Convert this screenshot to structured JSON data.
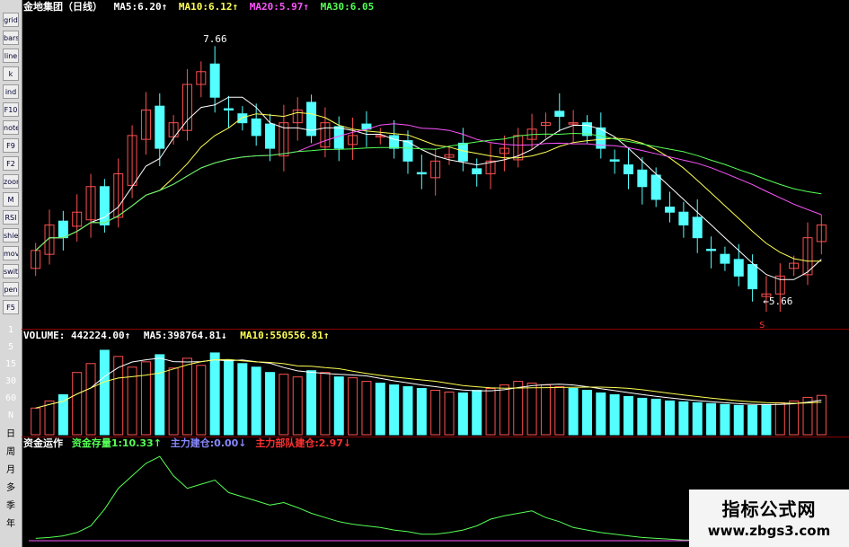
{
  "toolbar": {
    "buttons": [
      "grid",
      "bars",
      "line",
      "k",
      "ind",
      "F10",
      "note",
      "F9",
      "F2",
      "zoom",
      "M",
      "RSI",
      "shield",
      "move",
      "switch",
      "pen",
      "F5"
    ],
    "period_labels": [
      "日",
      "周",
      "月",
      "多",
      "季",
      "年"
    ]
  },
  "price_header": {
    "name": "金地集团（日线）",
    "ma5_label": "MA5:",
    "ma5_value": "6.20↑",
    "ma10_label": "MA10:",
    "ma10_value": "6.12↑",
    "ma20_label": "MA20:",
    "ma20_value": "5.97↑",
    "ma30_label": "MA30:",
    "ma30_value": "6.05"
  },
  "price_annotations": {
    "high": "7.66",
    "low": "←5.66",
    "marker": "S"
  },
  "volume_header": {
    "label": "VOLUME:",
    "value": "442224.00↑",
    "ma5_label": "MA5:",
    "ma5_value": "398764.81↓",
    "ma10_label": "MA10:",
    "ma10_value": "550556.81↑"
  },
  "volume_scale": [
    "1",
    "5",
    "15",
    "30",
    "60",
    "N"
  ],
  "fund_header": {
    "label": "资金运作",
    "stock_label": "资金存量1:",
    "stock_value": "10.33↑",
    "build_label": "主力建仓:",
    "build_value": "0.00↓",
    "troop_label": "主力部队建仓:",
    "troop_value": "2.97↓"
  },
  "watermark": {
    "title": "指标公式网",
    "url": "www.zbgs3.com"
  },
  "colors": {
    "up": "#ff5050",
    "down": "#54ffff",
    "ma5": "#ffffff",
    "ma10": "#ffff55",
    "ma20": "#ff55ff",
    "ma30": "#55ff55",
    "grid": "#8a0000"
  },
  "chart_data": {
    "type": "candlestick",
    "price_closes": [
      6.0,
      6.2,
      6.1,
      6.3,
      6.5,
      6.2,
      6.6,
      6.9,
      7.1,
      6.8,
      7.0,
      7.3,
      7.4,
      7.2,
      7.1,
      7.0,
      6.9,
      6.8,
      7.0,
      7.1,
      6.9,
      7.0,
      6.8,
      6.9,
      6.95,
      6.9,
      6.8,
      6.7,
      6.6,
      6.7,
      6.75,
      6.7,
      6.6,
      6.7,
      6.8,
      6.9,
      6.95,
      7.0,
      7.05,
      7.0,
      6.9,
      6.8,
      6.7,
      6.6,
      6.5,
      6.4,
      6.3,
      6.2,
      6.1,
      6.0,
      5.9,
      5.8,
      5.7,
      5.66,
      5.8,
      5.9,
      6.1,
      6.2
    ],
    "price_high": 7.66,
    "price_low": 5.66,
    "volume_values": [
      300,
      380,
      450,
      700,
      800,
      950,
      880,
      760,
      820,
      900,
      750,
      860,
      780,
      920,
      840,
      800,
      760,
      700,
      680,
      650,
      720,
      700,
      650,
      640,
      600,
      580,
      560,
      540,
      520,
      500,
      480,
      470,
      500,
      520,
      560,
      600,
      580,
      560,
      540,
      520,
      500,
      470,
      450,
      430,
      410,
      400,
      380,
      370,
      360,
      350,
      340,
      330,
      330,
      340,
      360,
      380,
      420,
      442
    ],
    "fund_values": [
      0.5,
      0.6,
      0.8,
      1.2,
      2.0,
      4.0,
      6.5,
      8.0,
      9.5,
      10.33,
      8.0,
      6.5,
      7.0,
      7.5,
      6.0,
      5.5,
      5.0,
      4.5,
      4.8,
      4.2,
      3.5,
      3.0,
      2.5,
      2.2,
      2.0,
      1.8,
      1.5,
      1.3,
      1.0,
      1.0,
      1.2,
      1.5,
      2.0,
      2.8,
      3.2,
      3.5,
      3.8,
      3.0,
      2.5,
      1.8,
      1.5,
      1.2,
      1.0,
      0.8,
      0.6,
      0.5,
      0.4,
      0.3,
      0.3,
      0.3,
      0.3,
      0.3,
      0.3,
      0.3,
      0.3,
      0.4,
      0.4,
      0.5
    ]
  }
}
